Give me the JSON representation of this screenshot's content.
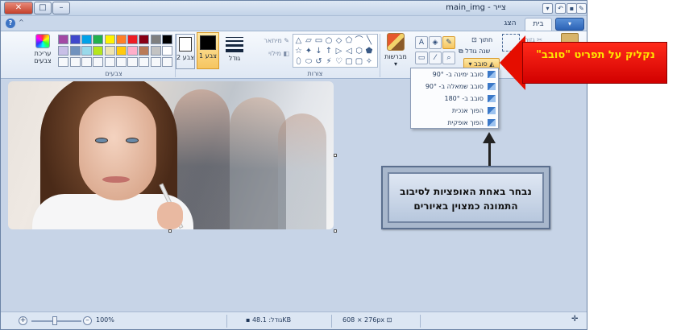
{
  "window": {
    "title": "main_img - צייר",
    "close": "✕",
    "maximize": "□",
    "minimize": "–"
  },
  "ribbon_tabs": {
    "home": "בית",
    "view": "הצג",
    "app_menu": "▾"
  },
  "colors": {
    "palette_row1": [
      "#000000",
      "#7f7f7f",
      "#880015",
      "#ed1c24",
      "#ff7f27",
      "#fff200",
      "#22b14c",
      "#00a2e8",
      "#3f48cc",
      "#a349a4"
    ],
    "palette_row2": [
      "#ffffff",
      "#c3c3c3",
      "#b97a57",
      "#ffaec9",
      "#ffc90e",
      "#efe4b0",
      "#b5e61d",
      "#99d9ea",
      "#7092be",
      "#c8bfe7"
    ],
    "color1_value": "#000000",
    "color2_value": "#ffffff",
    "accent_red": "#e50d00",
    "callout_yellow_text": "#ffe600"
  },
  "groups": {
    "colors_label": "צבעים",
    "shapes_label": "צורות",
    "edit_colors": "עריכת צבעים",
    "color1": "צבע 1",
    "color2": "צבע 2",
    "size": "גודל",
    "outline": "מיתאר",
    "fill": "מילוי",
    "brushes": "מברשות",
    "crop": "חתוך",
    "resize": "שנה גודל",
    "rotate": "סובב",
    "select": "בחר",
    "cut": "גזור"
  },
  "rotate_menu": {
    "items": [
      "סובב ימינה ב- 90°",
      "סובב שמאלה ב- 90°",
      "סובב ב- 180°",
      "הפוך אנכית",
      "הפוך אופקית"
    ]
  },
  "annotations": {
    "red_arrow_text": "נקליק על תפריט \"סובב\"",
    "callout_text": "נבחר באחת האופציות לסיבוב התמונה כמצוין באיורים"
  },
  "statusbar": {
    "zoom": "100%",
    "size_label": "גודל: 48.1KB",
    "dimensions": "608 × 276px"
  }
}
